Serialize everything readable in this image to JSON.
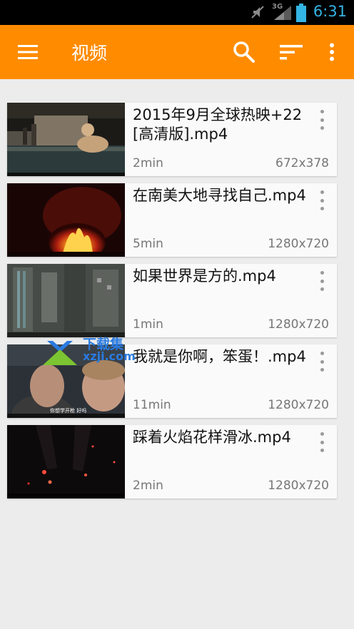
{
  "status_bar": {
    "time": "6:31",
    "network": "3G",
    "icons": [
      "mute-icon",
      "signal-icon",
      "battery-icon"
    ]
  },
  "toolbar": {
    "title": "视频",
    "icons": [
      "menu-icon",
      "search-icon",
      "sort-icon",
      "overflow-icon"
    ],
    "color": "#ff8c00"
  },
  "videos": [
    {
      "title": "2015年9月全球热映+22[高清版].mp4",
      "duration": "2min",
      "resolution": "672x378"
    },
    {
      "title": "在南美大地寻找自己.mp4",
      "duration": "5min",
      "resolution": "1280x720"
    },
    {
      "title": "如果世界是方的.mp4",
      "duration": "1min",
      "resolution": "1280x720"
    },
    {
      "title": "我就是你啊，笨蛋！.mp4",
      "duration": "11min",
      "resolution": "1280x720"
    },
    {
      "title": "踩着火焰花样滑冰.mp4",
      "duration": "2min",
      "resolution": "1280x720"
    }
  ],
  "thumbnail_captions": {
    "video_4": "你想学开枪 好吗"
  },
  "watermark": {
    "line1": "下载集",
    "line2": "xzji.com"
  }
}
